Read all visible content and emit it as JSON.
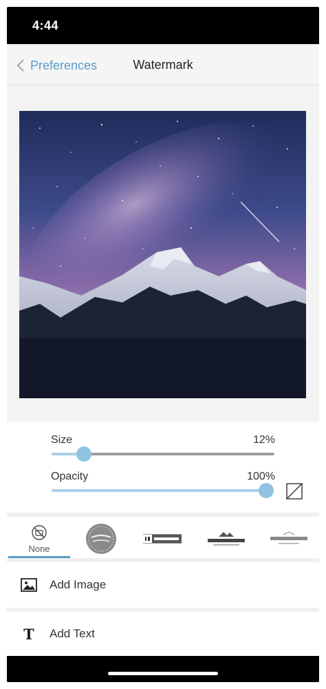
{
  "status_bar": {
    "time": "4:44"
  },
  "nav": {
    "back_label": "Preferences",
    "title": "Watermark"
  },
  "preview": {
    "image_description_icon": "mountain-night-sky-photo"
  },
  "sliders": {
    "size": {
      "label": "Size",
      "value": "12%",
      "fraction": 0.12
    },
    "opacity": {
      "label": "Opacity",
      "value": "100%",
      "fraction": 1.0
    }
  },
  "presets": {
    "none_label": "None",
    "items": [
      {
        "id": "none",
        "icon": "no-watermark-icon",
        "selected": true
      },
      {
        "id": "badge",
        "icon": "photoshop-express-badge-logo",
        "selected": false
      },
      {
        "id": "ps-express-box",
        "icon": "ps-express-box-logo",
        "selected": false
      },
      {
        "id": "ps-express-mountain",
        "icon": "ps-express-mountain-logo",
        "selected": false
      },
      {
        "id": "ps-express-script",
        "icon": "ps-express-script-logo",
        "selected": false
      }
    ]
  },
  "actions": {
    "add_image": {
      "label": "Add Image",
      "icon": "image-icon"
    },
    "add_text": {
      "label": "Add Text",
      "icon": "text-icon"
    }
  },
  "colors": {
    "accent": "#5b9bc7",
    "slider_fill": "#a9cfe6",
    "slider_thumb": "#8fc3e0"
  }
}
